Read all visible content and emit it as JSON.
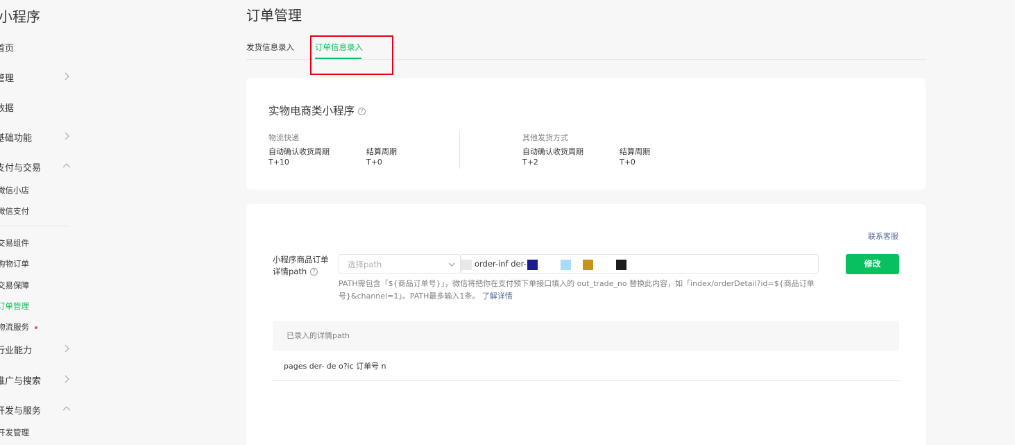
{
  "sidebar": {
    "app_title": "小程序",
    "items": [
      {
        "label": "首页"
      },
      {
        "label": "管理"
      },
      {
        "label": "数据"
      },
      {
        "label": "基础功能"
      },
      {
        "label": "支付与交易"
      },
      {
        "label": "行业能力"
      },
      {
        "label": "推广与搜索"
      },
      {
        "label": "开发与服务"
      }
    ],
    "subitems": [
      {
        "label": "微信小店"
      },
      {
        "label": "微信支付"
      },
      {
        "label": "交易组件"
      },
      {
        "label": "购物订单"
      },
      {
        "label": "交易保障"
      },
      {
        "label": "订单管理"
      },
      {
        "label": "物流服务"
      },
      {
        "label": "开发管理"
      }
    ]
  },
  "page": {
    "title": "订单管理",
    "tabs": [
      {
        "label": "发货信息录入"
      },
      {
        "label": "订单信息录入"
      }
    ]
  },
  "category_card": {
    "title": "实物电商类小程序",
    "logistics": {
      "title": "物流快递",
      "auto_confirm_label": "自动确认收货周期",
      "auto_confirm_value": "T+10",
      "settle_label": "结算周期",
      "settle_value": "T+0"
    },
    "other": {
      "title": "其他发货方式",
      "auto_confirm_label": "自动确认收货周期",
      "auto_confirm_value": "T+2",
      "settle_label": "结算周期",
      "settle_value": "T+0"
    }
  },
  "path_card": {
    "contact_link": "联系客服",
    "field_label": "小程序商品订单详情path",
    "select_placeholder": "选择path",
    "input_value": "g      order-inf        der-      'i",
    "edit_button": "修改",
    "hint_text": "PATH需包含「${商品订单号}」，微信将把你在支付预下单接口填入的 out_trade_no 替换此内容，如「index/orderDetail?id=${商品订单号}&channel=1」。PATH最多输入1条。",
    "hint_link": "了解详情",
    "table_header": "已录入的详情path",
    "table_row": "pages     der-         de    o?ic           订单号    n"
  },
  "colors": {
    "accent": "#07c160",
    "link": "#576b95",
    "highlight": "#e60012"
  }
}
